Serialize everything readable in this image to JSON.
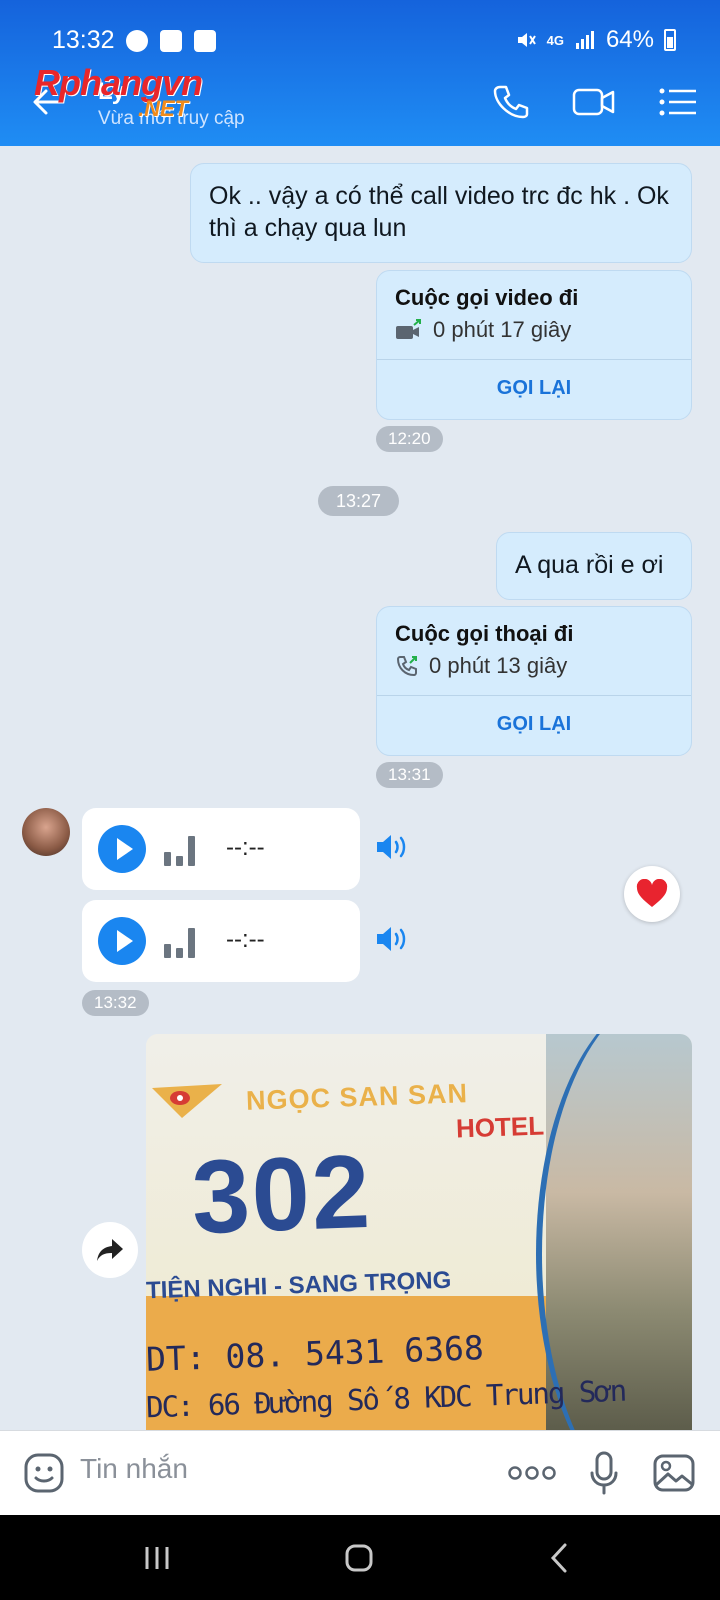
{
  "status_bar": {
    "time": "13:32",
    "network": "4G",
    "battery": "64%"
  },
  "header": {
    "contact_name": "Ly",
    "contact_status": "Vừa mới truy cập",
    "watermark_main": "Rphangvn",
    "watermark_sub": ".NET",
    "icons": [
      "back-arrow-icon",
      "phone-icon",
      "video-camera-icon",
      "menu-list-icon"
    ]
  },
  "messages": {
    "msg1_text": "Ok .. vậy a có thể call video trc đc hk . Ok thì a chạy qua lun",
    "call1": {
      "title": "Cuộc gọi video đi",
      "duration": "0 phút 17 giây",
      "action": "GỌI LẠI"
    },
    "time1": "12:20",
    "divider_time": "13:27",
    "msg2_text": "A qua rồi e ơi",
    "call2": {
      "title": "Cuộc gọi thoại đi",
      "duration": "0 phút 13 giây",
      "action": "GỌI LẠI"
    },
    "time2": "13:31",
    "voice1_time": "--:--",
    "voice2_time": "--:--",
    "time3": "13:32",
    "reaction": "heart"
  },
  "hotel_image": {
    "name": "NGỌC SAN SAN",
    "word": "HOTEL",
    "room": "302",
    "slogan": "TIỆN NGHI - SANG TRỌNG",
    "phone": "DT: 08. 5431 6368",
    "address": "DC: 66 Đường Số 8 KDC Trung Sơn"
  },
  "input_bar": {
    "placeholder": "Tin nhắn",
    "more_label": "ooo"
  },
  "colors": {
    "header_top": "#1563dc",
    "header_bottom": "#1f8df4",
    "bubble_out": "#d5ecfd",
    "accent": "#1a86f0",
    "background": "#e2e9f1"
  }
}
